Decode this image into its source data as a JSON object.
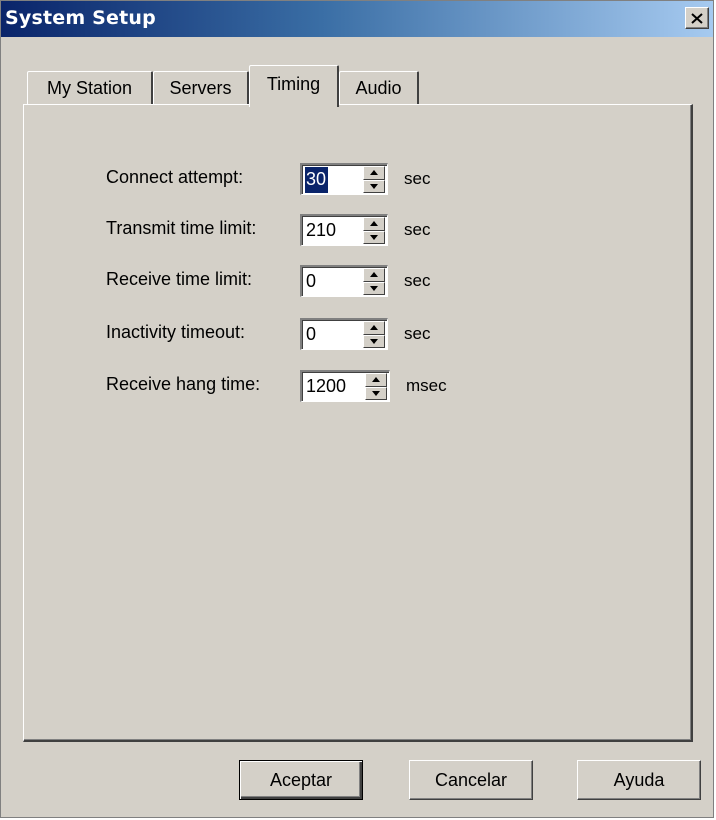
{
  "window": {
    "title": "System Setup",
    "close_glyph": "close-icon"
  },
  "tabs": [
    {
      "label": "My Station",
      "active": false
    },
    {
      "label": "Servers",
      "active": false
    },
    {
      "label": "Timing",
      "active": true
    },
    {
      "label": "Audio",
      "active": false
    }
  ],
  "timing": {
    "connect_attempt": {
      "label": "Connect attempt:",
      "value": "30",
      "unit": "sec"
    },
    "transmit_limit": {
      "label": "Transmit time limit:",
      "value": "210",
      "unit": "sec"
    },
    "receive_limit": {
      "label": "Receive time limit:",
      "value": "0",
      "unit": "sec"
    },
    "inactivity_timeout": {
      "label": "Inactivity timeout:",
      "value": "0",
      "unit": "sec"
    },
    "receive_hang": {
      "label": "Receive hang time:",
      "value": "1200",
      "unit": "msec"
    }
  },
  "buttons": {
    "ok": "Aceptar",
    "cancel": "Cancelar",
    "help": "Ayuda"
  },
  "colors": {
    "titlebar_start": "#0a246a",
    "titlebar_end": "#a6caf0",
    "face": "#d4d0c8",
    "selection": "#0a246a"
  }
}
